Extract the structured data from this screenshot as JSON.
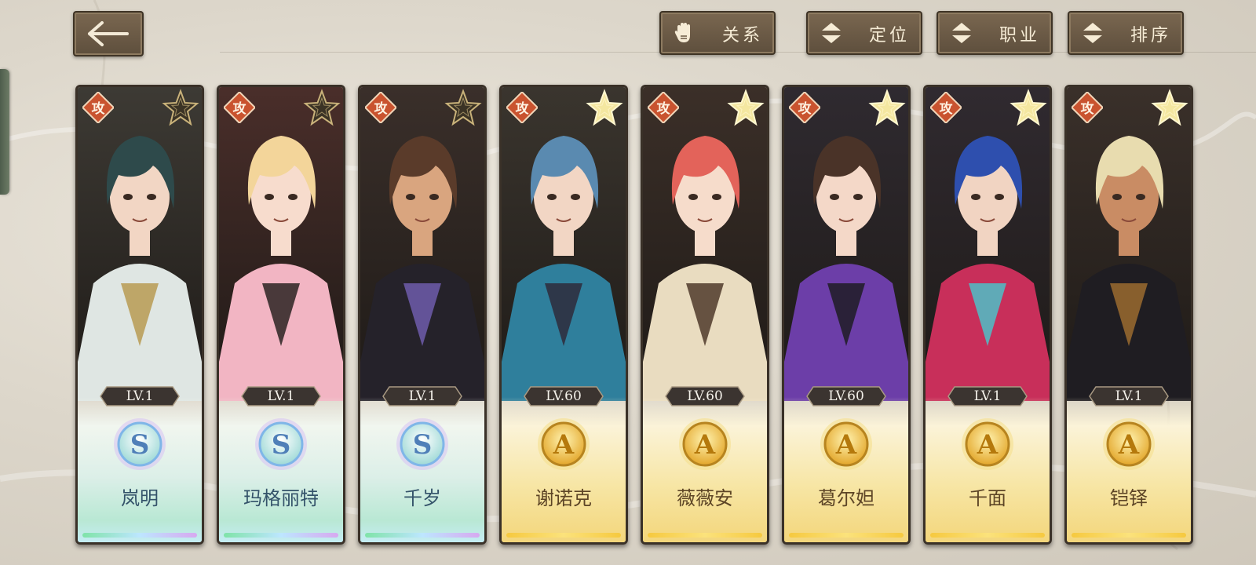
{
  "header": {
    "back_icon": "left-arrow-icon",
    "buttons": [
      {
        "label": "关系",
        "icon": "glove-hand-icon"
      },
      {
        "label": "定位",
        "icon": "up-down-sort-icon"
      },
      {
        "label": "职业",
        "icon": "up-down-sort-icon"
      },
      {
        "label": "排序",
        "icon": "up-down-sort-icon"
      }
    ]
  },
  "colors": {
    "button_bg": "#6b5a45",
    "button_text": "#f6ecd6",
    "role_badge": "#c9532f",
    "star_gold": "#f4e7a0",
    "star_dark": "#3b3325"
  },
  "characters": [
    {
      "name": "岚明",
      "level": "LV.1",
      "rank": "S",
      "role": "攻",
      "star_style": "dark",
      "hair": "#2e4a4b",
      "skin": "#f2d6c4",
      "outfit": "#dfe6e3",
      "accent": "#b89a52",
      "bg": "#3d3a34"
    },
    {
      "name": "玛格丽特",
      "level": "LV.1",
      "rank": "S",
      "role": "攻",
      "star_style": "dark",
      "hair": "#f3d59a",
      "skin": "#f7dccd",
      "outfit": "#f2b5c3",
      "accent": "#2b2322",
      "bg": "#4a2e2a"
    },
    {
      "name": "千岁",
      "level": "LV.1",
      "rank": "S",
      "role": "攻",
      "star_style": "dark",
      "hair": "#5a3b2a",
      "skin": "#d9a57f",
      "outfit": "#25222a",
      "accent": "#6f5cab",
      "bg": "#3a2f2a"
    },
    {
      "name": "谢诺克",
      "level": "LV.60",
      "rank": "A",
      "role": "攻",
      "star_style": "gold",
      "hair": "#5a8ab0",
      "skin": "#f2d6c4",
      "outfit": "#2f7f9c",
      "accent": "#2e2a3b",
      "bg": "#3a352e"
    },
    {
      "name": "薇薇安",
      "level": "LV.60",
      "rank": "A",
      "role": "攻",
      "star_style": "gold",
      "hair": "#e3635a",
      "skin": "#f6dccb",
      "outfit": "#e9dcc0",
      "accent": "#4f3a2a",
      "bg": "#3b2f28"
    },
    {
      "name": "葛尔妲",
      "level": "LV.60",
      "rank": "A",
      "role": "攻",
      "star_style": "gold",
      "hair": "#4a3328",
      "skin": "#f4d8c8",
      "outfit": "#6c3ea8",
      "accent": "#1f1c24",
      "bg": "#2f2a30"
    },
    {
      "name": "千面",
      "level": "LV.1",
      "rank": "A",
      "role": "攻",
      "star_style": "gold",
      "hair": "#2e4fae",
      "skin": "#f1d4c2",
      "outfit": "#c82f5a",
      "accent": "#4dc0c8",
      "bg": "#302a30"
    },
    {
      "name": "铠铎",
      "level": "LV.1",
      "rank": "A",
      "role": "攻",
      "star_style": "gold",
      "hair": "#e8dcaf",
      "skin": "#c98c64",
      "outfit": "#1f1d22",
      "accent": "#9b6b2f",
      "bg": "#3a302a"
    }
  ]
}
